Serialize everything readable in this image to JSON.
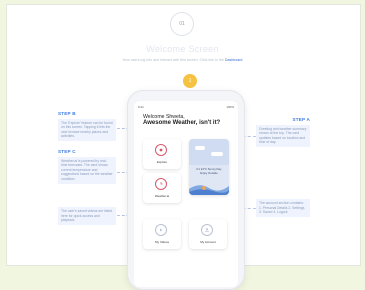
{
  "header": {
    "step_number": "01",
    "title": "Welcome Screen",
    "subtitle_text": "How users log into and interact with this screen. Click link to the",
    "subtitle_link": "Dashboard"
  },
  "phone": {
    "marker": "1",
    "status_time": "9:41",
    "status_right": "100%",
    "greeting_line1": "Welcome Shweta,",
    "greeting_line2": "Awesome Weather, isn't it?",
    "tiles": {
      "explore": "Explore",
      "weather": "Weather.ai",
      "videos": "My Videos",
      "account": "My Account",
      "weather_card_line1": "It's 24°C Sunny Day",
      "weather_card_line2": "Enjoy Outside"
    }
  },
  "callouts": {
    "step_b": {
      "heading": "STEP B",
      "body": "The 'Explore' feature can be found on this screen. Tapping it lets the user browse nearby places and activities."
    },
    "step_c": {
      "heading": "STEP C",
      "body": "Weather.ai is powered by real-time forecasts. The card shows current temperature and suggestions based on the weather condition."
    },
    "step_d": {
      "body": "The user's saved videos are listed here for quick access and playback."
    },
    "step_a": {
      "heading": "STEP A",
      "body": "Greeting and weather summary shown at the top. The card updates based on location and time of day."
    },
    "step_e": {
      "body": "The account section contains: 1. Personal Details 2. Settings 3. Saved 4. Logout"
    }
  },
  "colors": {
    "accent_blue": "#3b7be0",
    "marker_yellow": "#f5c242",
    "icon_red": "#d8596d"
  }
}
